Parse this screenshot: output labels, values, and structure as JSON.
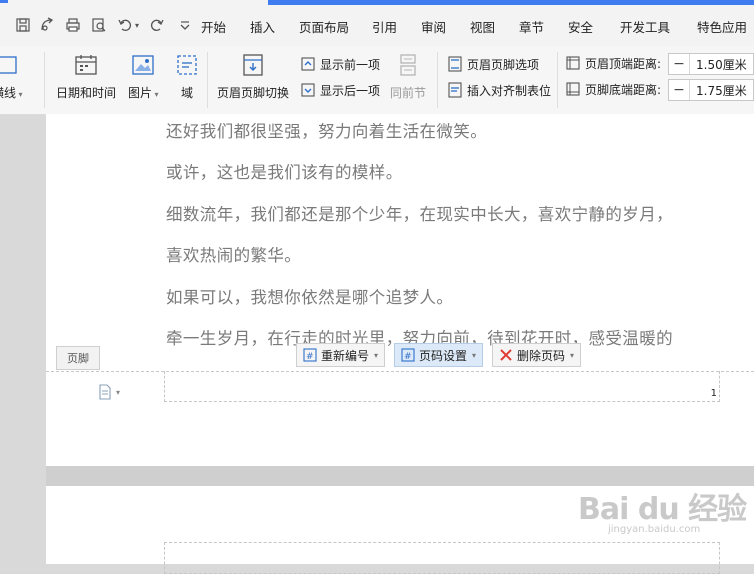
{
  "menu": {
    "items": [
      "开始",
      "插入",
      "页面布局",
      "引用",
      "审阅",
      "视图",
      "章节",
      "安全",
      "开发工具",
      "特色应用"
    ]
  },
  "ribbon": {
    "horizontal_line": "横线",
    "date_time": "日期和时间",
    "picture": "图片",
    "field": "域",
    "header_footer_switch": "页眉页脚切换",
    "show_prev": "显示前一项",
    "show_next": "显示后一项",
    "same_as_prev": "同前节",
    "header_footer_options": "页眉页脚选项",
    "insert_align_tab": "插入对齐制表位",
    "header_top_distance_label": "页眉顶端距离:",
    "header_top_distance_value": "1.50厘米",
    "footer_bottom_distance_label": "页脚底端距离:",
    "footer_bottom_distance_value": "1.75厘米"
  },
  "document": {
    "paragraphs": [
      "还好我们都很坚强，努力向着生活在微笑。",
      "或许，这也是我们该有的模样。",
      "细数流年，我们都还是那个少年，在现实中长大，喜欢宁静的岁月，",
      "喜欢热闹的繁华。",
      "如果可以，我想你依然是哪个追梦人。",
      "牵一生岁月，在行走的时光里，努力向前，待到花开时，感受温暖的"
    ],
    "footer_tag": "页脚",
    "footer_buttons": {
      "renumber": "重新编号",
      "page_number_settings": "页码设置",
      "delete_page_number": "删除页码"
    },
    "page_number": "1"
  },
  "watermark": {
    "logo": "Bai du 经验",
    "url": "jingyan.baidu.com"
  },
  "colors": {
    "accent": "#3f7cf0",
    "delete_red": "#e03c31"
  }
}
